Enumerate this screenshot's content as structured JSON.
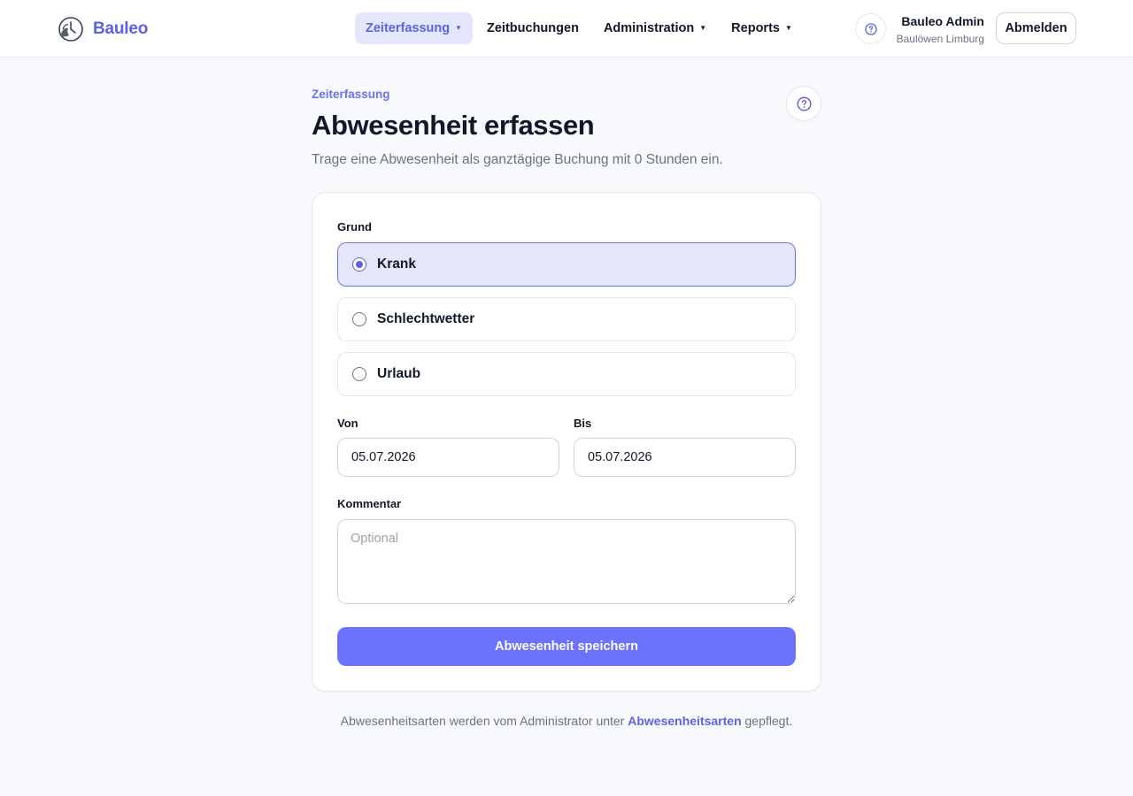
{
  "header": {
    "brand": "Bauleo",
    "nav": [
      {
        "label": "Zeiterfassung"
      },
      {
        "label": "Zeitbuchungen"
      },
      {
        "label": "Administration"
      },
      {
        "label": "Reports"
      }
    ],
    "user_name": "Bauleo Admin",
    "user_org": "Baulöwen Limburg",
    "logout_label": "Abmelden"
  },
  "page": {
    "eyebrow": "Zeiterfassung",
    "title": "Abwesenheit erfassen",
    "subtitle": "Trage eine Abwesenheit als ganztägige Buchung mit 0 Stunden ein."
  },
  "form": {
    "reason_label": "Grund",
    "reasons": [
      {
        "label": "Krank",
        "selected": true
      },
      {
        "label": "Schlechtwetter",
        "selected": false
      },
      {
        "label": "Urlaub",
        "selected": false
      }
    ],
    "from_label": "Von",
    "from_value": "05.07.2026",
    "to_label": "Bis",
    "to_value": "05.07.2026",
    "comment_label": "Kommentar",
    "comment_placeholder": "Optional",
    "comment_value": "",
    "save_label": "Abwesenheit speichern"
  },
  "footer": {
    "text_before": "Abwesenheitsarten werden vom Administrator unter ",
    "link_label": "Abwesenheitsarten",
    "text_after": " gepflegt."
  },
  "colors": {
    "accent": "#6c72fe",
    "accent_soft": "#e4e6fb",
    "brand": "#5b63e6"
  }
}
